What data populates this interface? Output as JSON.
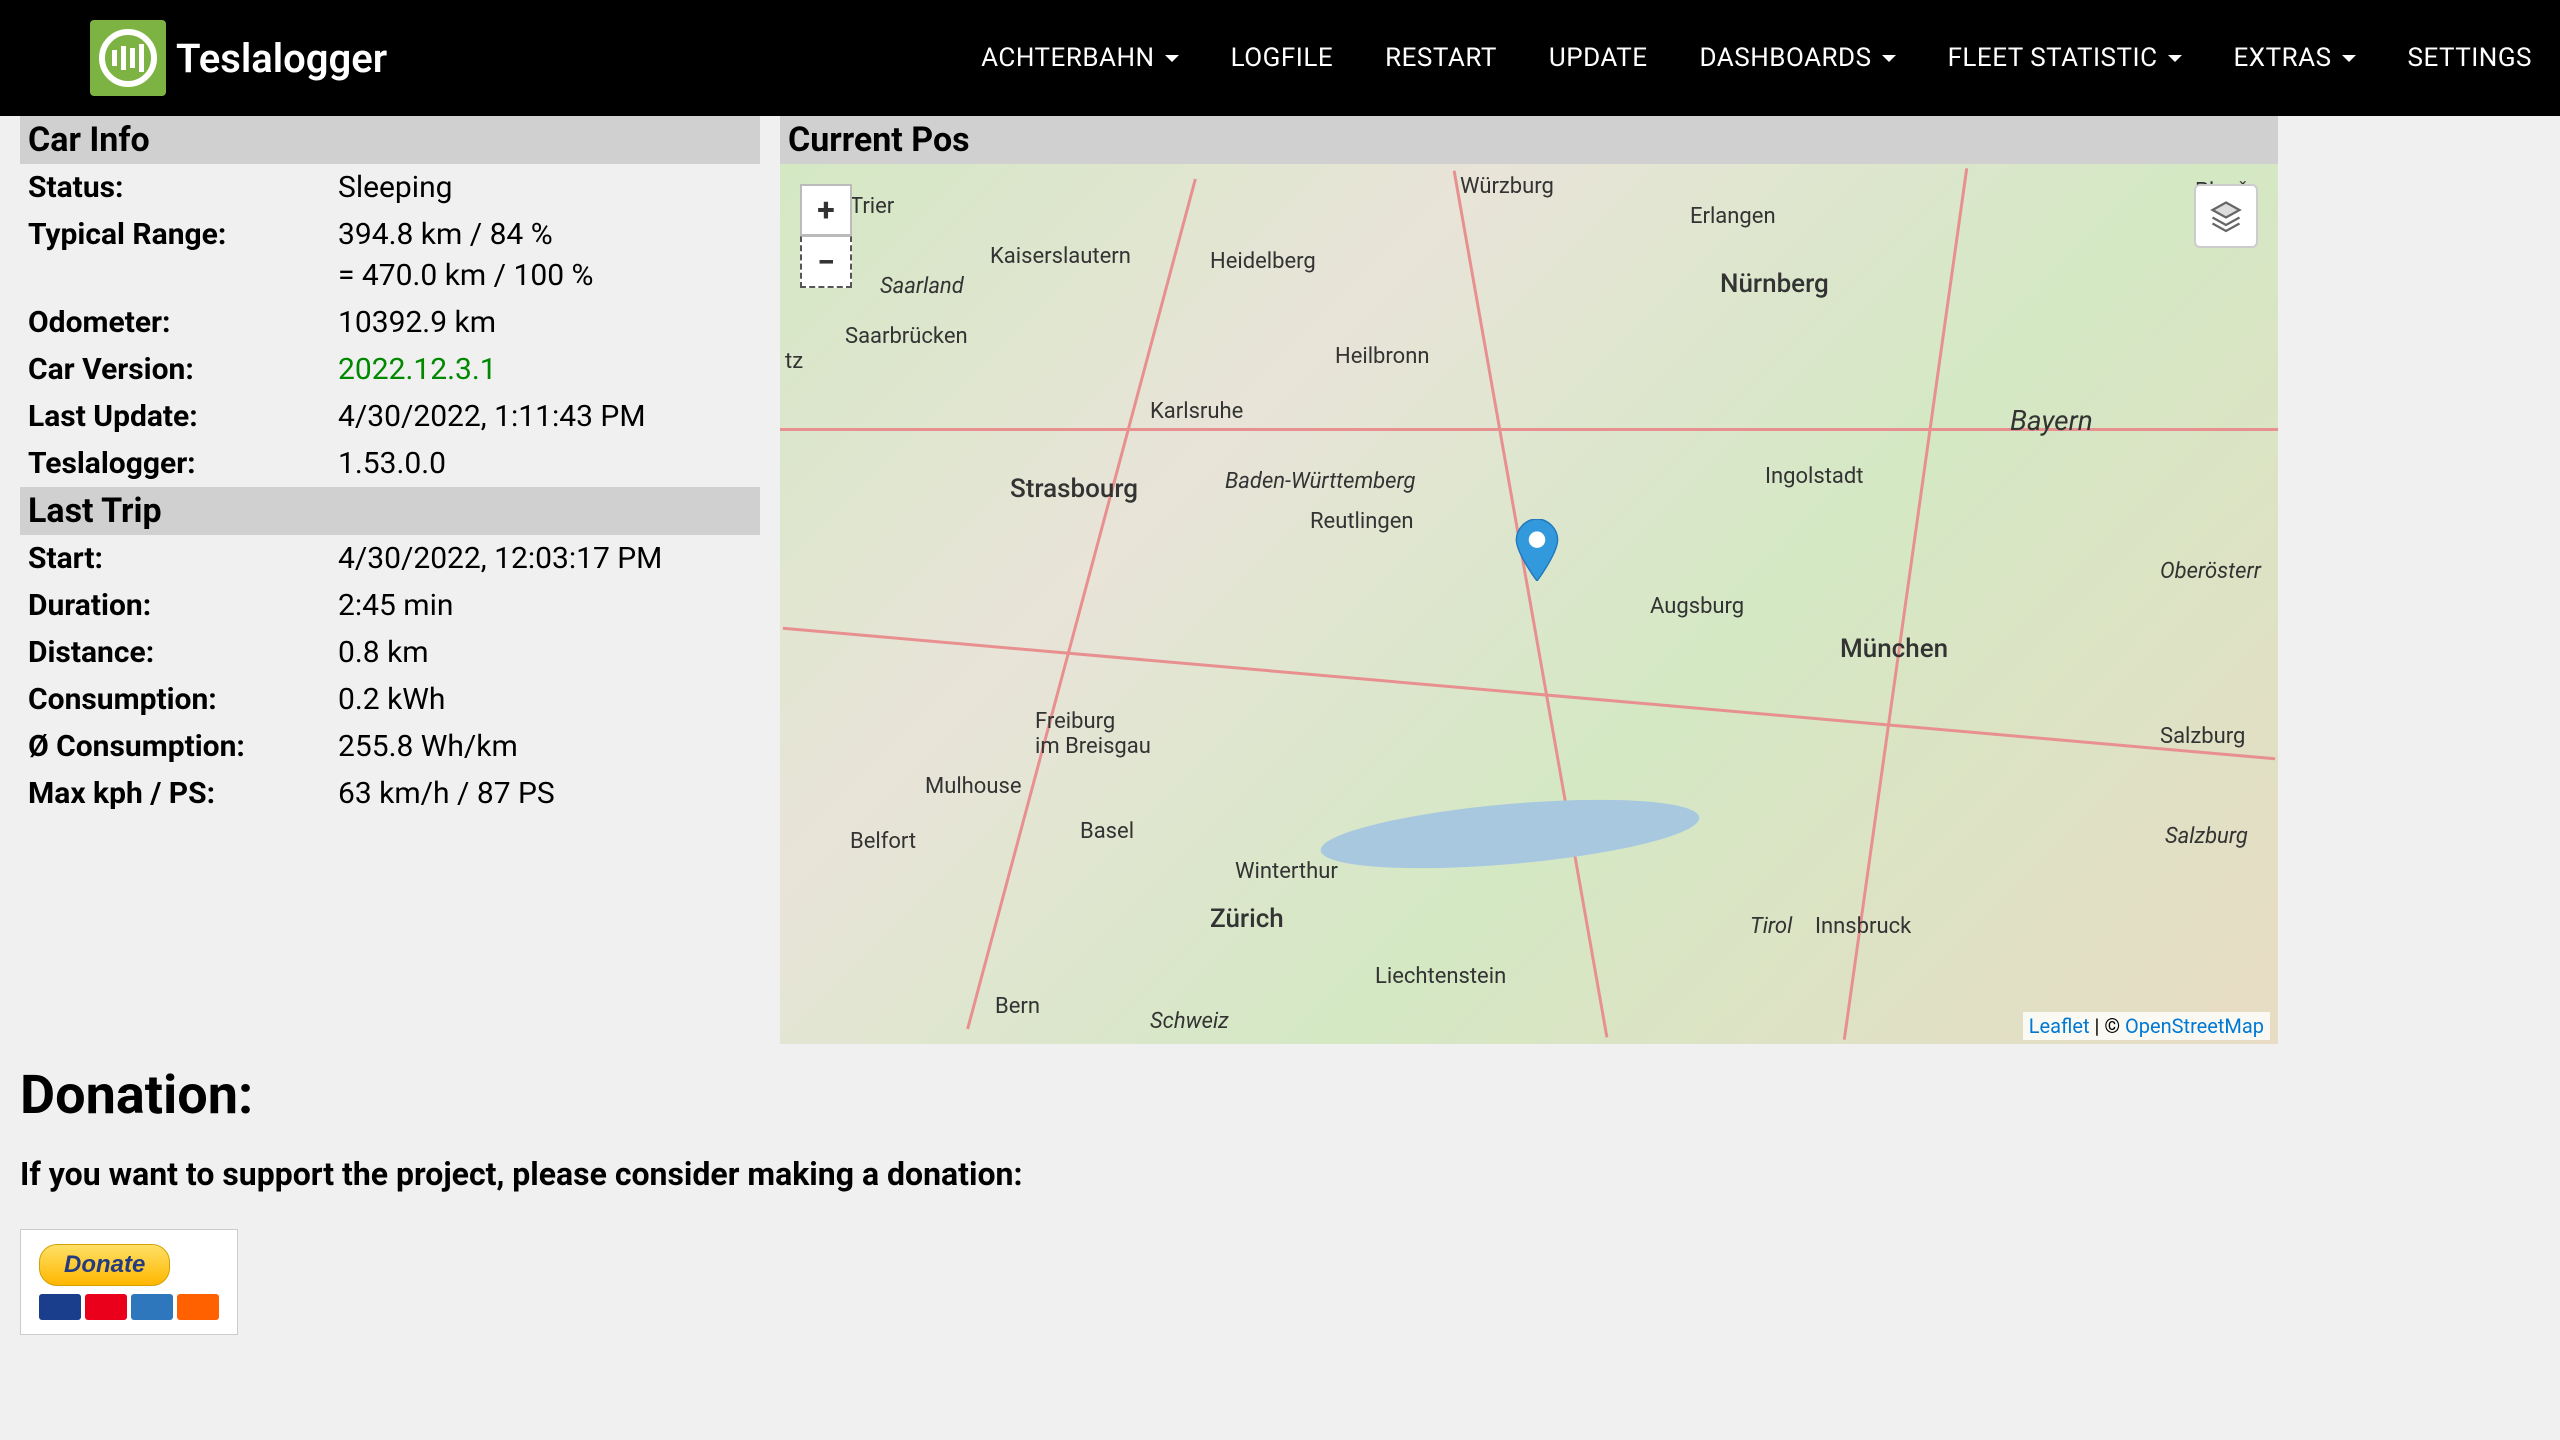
{
  "brand": "Teslalogger",
  "nav": {
    "achterbahn": "ACHTERBAHN",
    "logfile": "LOGFILE",
    "restart": "RESTART",
    "update": "UPDATE",
    "dashboards": "DASHBOARDS",
    "fleet_statistic": "FLEET STATISTIC",
    "extras": "EXTRAS",
    "settings": "SETTINGS"
  },
  "car_info": {
    "header": "Car Info",
    "status_label": "Status:",
    "status_value": "Sleeping",
    "typical_range_label": "Typical Range:",
    "typical_range_value": "394.8 km / 84 %",
    "typical_range_sub": "= 470.0 km / 100 %",
    "odometer_label": "Odometer:",
    "odometer_value": "10392.9 km",
    "car_version_label": "Car Version:",
    "car_version_value": "2022.12.3.1",
    "last_update_label": "Last Update:",
    "last_update_value": "4/30/2022, 1:11:43 PM",
    "teslalogger_label": "Teslalogger:",
    "teslalogger_value": "1.53.0.0"
  },
  "last_trip": {
    "header": "Last Trip",
    "start_label": "Start:",
    "start_value": "4/30/2022, 12:03:17 PM",
    "duration_label": "Duration:",
    "duration_value": "2:45 min",
    "distance_label": "Distance:",
    "distance_value": "0.8 km",
    "consumption_label": "Consumption:",
    "consumption_value": "0.2 kWh",
    "avg_consumption_label": "Ø Consumption:",
    "avg_consumption_value": "255.8 Wh/km",
    "max_kph_label": "Max kph / PS:",
    "max_kph_value": "63 km/h / 87 PS"
  },
  "map": {
    "header": "Current Pos",
    "attribution_leaflet": "Leaflet",
    "attribution_sep": " | © ",
    "attribution_osm": "OpenStreetMap",
    "cities": {
      "wurzburg": "Würzburg",
      "trier": "Trier",
      "erlangen": "Erlangen",
      "kaiserslautern": "Kaiserslautern",
      "heidelberg": "Heidelberg",
      "nurnberg": "Nürnberg",
      "saarland": "Saarland",
      "saarbrucken": "Saarbrücken",
      "heilbronn": "Heilbronn",
      "karlsruhe": "Karlsruhe",
      "strasbourg": "Strasbourg",
      "baden": "Baden-Württemberg",
      "reutlingen": "Reutlingen",
      "ingolstadt": "Ingolstadt",
      "bayern": "Bayern",
      "augsburg": "Augsburg",
      "munchen": "München",
      "freiburg": "Freiburg\nim Breisgau",
      "mulhouse": "Mulhouse",
      "basel": "Basel",
      "belfort": "Belfort",
      "winterthur": "Winterthur",
      "zurich": "Zürich",
      "bern": "Bern",
      "schweiz": "Schweiz",
      "liechtenstein": "Liechtenstein",
      "salzburg": "Salzburg",
      "salzburg2": "Salzburg",
      "oberosterr": "Oberösterr",
      "tirol": "Tirol",
      "innsbruck": "Innsbruck",
      "tz": "tz",
      "plzen": "Plzeň"
    }
  },
  "donation": {
    "title": "Donation:",
    "text": "If you want to support the project, please consider making a donation:",
    "button": "Donate"
  }
}
